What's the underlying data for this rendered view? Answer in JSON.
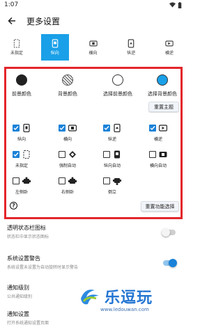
{
  "status": {
    "time": "1:07"
  },
  "app_bar": {
    "title": "更多设置"
  },
  "tabs": [
    {
      "label": "未指定",
      "active": false
    },
    {
      "label": "纵向",
      "active": true
    },
    {
      "label": "横向",
      "active": false
    },
    {
      "label": "纵逆",
      "active": false
    },
    {
      "label": "横逆",
      "active": false
    }
  ],
  "colors": [
    {
      "label": "前景颜色",
      "color": "#222222"
    },
    {
      "label": "背景颜色",
      "color": "checker"
    },
    {
      "label": "选择前景颜色",
      "color": "#ffffff"
    },
    {
      "label": "选择背景颜色",
      "color": "#1aa0e8"
    }
  ],
  "reset_theme": "重置主题",
  "options": [
    {
      "label": "纵向",
      "checked": true,
      "icon": "portrait-icon"
    },
    {
      "label": "横向",
      "checked": true,
      "icon": "landscape-icon"
    },
    {
      "label": "纵逆",
      "checked": true,
      "icon": "reverse-portrait-icon"
    },
    {
      "label": "横逆",
      "checked": true,
      "icon": "reverse-landscape-icon"
    },
    {
      "label": "未指定",
      "checked": true,
      "icon": "unspecified-icon"
    },
    {
      "label": "强制自动",
      "checked": false,
      "icon": "force-auto-icon"
    },
    {
      "label": "纵向自动",
      "checked": false,
      "icon": "portrait-auto-icon"
    },
    {
      "label": "横向自动",
      "checked": false,
      "icon": "landscape-auto-icon"
    },
    {
      "label": "左侧卧",
      "checked": false,
      "icon": "lie-left-icon"
    },
    {
      "label": "右侧卧",
      "checked": false,
      "icon": "lie-right-icon"
    },
    {
      "label": "倒立",
      "checked": false,
      "icon": "handstand-icon"
    }
  ],
  "reset_function": "重置功能选择",
  "settings": [
    {
      "title": "透明状态栏图标",
      "sub": "状态栏中显示状态图标",
      "on": false
    },
    {
      "title": "系统设置警告",
      "sub": "系统设置未设置为自动旋转时显示警告",
      "on": true
    },
    {
      "title": "通知级别",
      "sub": "公共通知级别",
      "on": null
    },
    {
      "title": "通知设置",
      "sub": "打开系统通知设置页面",
      "on": null
    }
  ],
  "watermark": {
    "text": "乐逗玩",
    "url": "www.ledouwan.com"
  },
  "accent": "#1a82d8",
  "frame_color": "#e3262b"
}
